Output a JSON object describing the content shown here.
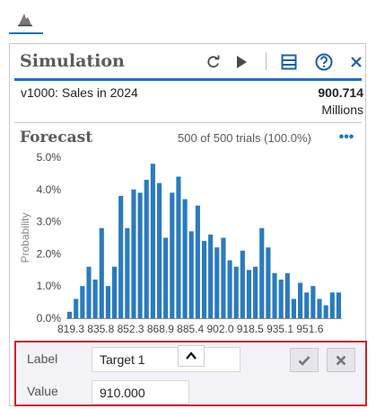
{
  "header": {
    "title": "Simulation",
    "icons": [
      "refresh-icon",
      "play-icon",
      "panel-icon",
      "help-icon",
      "close-icon"
    ]
  },
  "forecast": {
    "name": "v1000: Sales in 2024",
    "value": "900.714",
    "units": "Millions"
  },
  "chart_section": {
    "title": "Forecast",
    "trials": "500 of 500 trials (100.0%)"
  },
  "chart_data": {
    "type": "bar",
    "ylabel": "Probability",
    "ylim": [
      0,
      5.0
    ],
    "yticks": [
      "5.0%",
      "4.0%",
      "3.0%",
      "2.0%",
      "1.0%",
      "0.0%"
    ],
    "xtick_labels": [
      "819.3",
      "835.8",
      "852.3",
      "868.9",
      "885.4",
      "902.0",
      "918.5",
      "935.1",
      "951.6"
    ],
    "values": [
      0.2,
      0.6,
      1.0,
      1.6,
      1.2,
      2.8,
      1.0,
      1.6,
      3.8,
      2.8,
      4.0,
      3.9,
      4.3,
      4.8,
      4.2,
      2.5,
      3.9,
      4.4,
      3.7,
      2.7,
      3.5,
      2.4,
      2.6,
      2.2,
      2.5,
      1.8,
      1.6,
      2.1,
      1.5,
      1.6,
      2.8,
      2.2,
      1.4,
      1.2,
      1.4,
      0.6,
      1.1,
      0.8,
      1.0,
      0.6,
      0.4,
      0.8,
      0.8
    ],
    "colors": {
      "bar": "#2a7bbd",
      "axis": "#8a8a8a",
      "text": "#444444"
    },
    "grid": false
  },
  "target": {
    "label_caption": "Label",
    "label_value": "Target 1",
    "value_caption": "Value",
    "value_value": "910.000",
    "confirm_icon": "check-icon",
    "cancel_icon": "x-icon"
  },
  "colors": {
    "accent": "#1a73c6",
    "highlight_border": "#d21f26"
  }
}
